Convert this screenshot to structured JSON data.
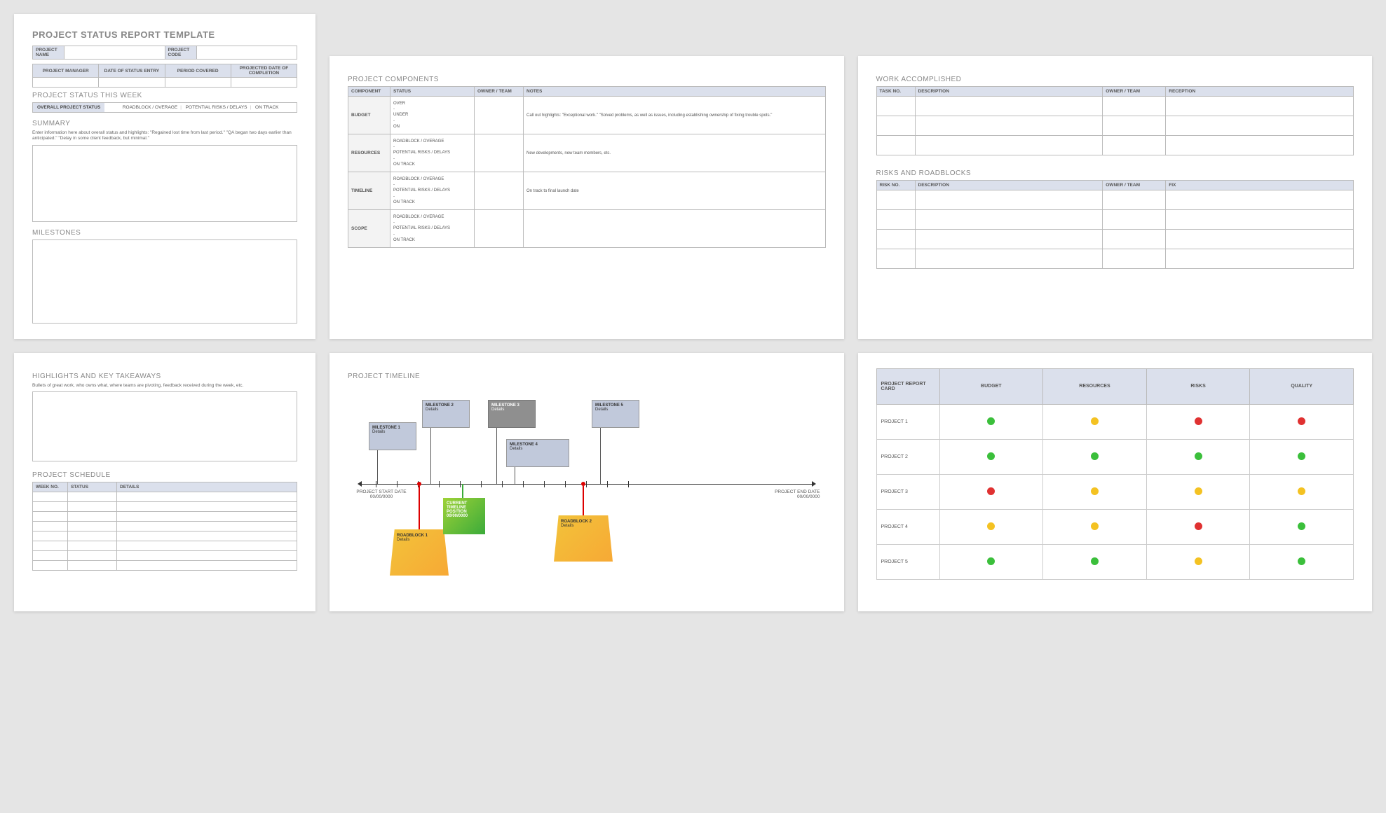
{
  "page1": {
    "title": "PROJECT STATUS REPORT TEMPLATE",
    "meta": {
      "name": "PROJECT NAME",
      "code": "PROJECT CODE"
    },
    "dates": {
      "manager": "PROJECT MANAGER",
      "entry": "DATE OF STATUS ENTRY",
      "period": "PERIOD COVERED",
      "completion": "PROJECTED DATE OF COMPLETION"
    },
    "weekTitle": "PROJECT STATUS THIS WEEK",
    "statusLabel": "OVERALL PROJECT STATUS",
    "statusOpts": [
      "ROADBLOCK / OVERAGE",
      "POTENTIAL RISKS / DELAYS",
      "ON TRACK"
    ],
    "summaryTitle": "SUMMARY",
    "summaryDesc": "Enter information here about overall status and highlights: \"Regained lost time from last period.\" \"QA began two days earlier than anticipated.\" \"Delay in some client feedback, but minimal.\"",
    "milestonesTitle": "MILESTONES"
  },
  "components": {
    "title": "PROJECT COMPONENTS",
    "headers": [
      "COMPONENT",
      "STATUS",
      "OWNER / TEAM",
      "NOTES"
    ],
    "rows": [
      {
        "label": "BUDGET",
        "status": "OVER\n-\nUNDER\n-\nON",
        "notes": "Call out highlights: \"Exceptional work.\" \"Solved problems, as well as issues, including establishing ownership of fixing trouble spots.\""
      },
      {
        "label": "RESOURCES",
        "status": "ROADBLOCK / OVERAGE\n-\nPOTENTIAL RISKS / DELAYS\n-\nON TRACK",
        "notes": "New developments, new team members, etc."
      },
      {
        "label": "TIMELINE",
        "status": "ROADBLOCK / OVERAGE\n-\nPOTENTIAL RISKS / DELAYS\n-\nON TRACK",
        "notes": "On track to final launch date"
      },
      {
        "label": "SCOPE",
        "status": "ROADBLOCK / OVERAGE\n-\nPOTENTIAL RISKS / DELAYS\n-\nON TRACK",
        "notes": ""
      }
    ]
  },
  "work": {
    "title": "WORK ACCOMPLISHED",
    "headers": [
      "TASK NO.",
      "DESCRIPTION",
      "OWNER / TEAM",
      "RECEPTION"
    ]
  },
  "risks": {
    "title": "RISKS AND ROADBLOCKS",
    "headers": [
      "RISK NO.",
      "DESCRIPTION",
      "OWNER / TEAM",
      "FIX"
    ]
  },
  "highlights": {
    "title": "HIGHLIGHTS AND KEY TAKEAWAYS",
    "desc": "Bullets of great work, who owns what, where teams are pivoting, feedback received during the week, etc."
  },
  "schedule": {
    "title": "PROJECT SCHEDULE",
    "headers": [
      "WEEK NO.",
      "STATUS",
      "DETAILS"
    ]
  },
  "timeline": {
    "title": "PROJECT TIMELINE",
    "start": {
      "label": "PROJECT START DATE",
      "date": "00/00/0000"
    },
    "end": {
      "label": "PROJECT END DATE",
      "date": "00/00/0000"
    },
    "milestones": [
      {
        "name": "MILESTONE 1",
        "sub": "Details"
      },
      {
        "name": "MILESTONE 2",
        "sub": "Details"
      },
      {
        "name": "MILESTONE 3",
        "sub": "Details"
      },
      {
        "name": "MILESTONE 4",
        "sub": "Details"
      },
      {
        "name": "MILESTONE 5",
        "sub": "Details"
      }
    ],
    "current": {
      "l1": "CURRENT",
      "l2": "TIMELINE",
      "l3": "POSITION",
      "date": "00/00/0000"
    },
    "roadblocks": [
      {
        "name": "ROADBLOCK 1",
        "sub": "Details"
      },
      {
        "name": "ROADBLOCK 2",
        "sub": "Details"
      }
    ]
  },
  "reportcard": {
    "headers": [
      "PROJECT REPORT CARD",
      "BUDGET",
      "RESOURCES",
      "RISKS",
      "QUALITY"
    ],
    "rows": [
      {
        "label": "PROJECT 1",
        "lights": [
          "g",
          "y",
          "r",
          "r"
        ]
      },
      {
        "label": "PROJECT 2",
        "lights": [
          "g",
          "g",
          "g",
          "g"
        ]
      },
      {
        "label": "PROJECT 3",
        "lights": [
          "r",
          "y",
          "y",
          "y"
        ]
      },
      {
        "label": "PROJECT 4",
        "lights": [
          "y",
          "y",
          "r",
          "g"
        ]
      },
      {
        "label": "PROJECT 5",
        "lights": [
          "g",
          "g",
          "y",
          "g"
        ]
      }
    ]
  }
}
